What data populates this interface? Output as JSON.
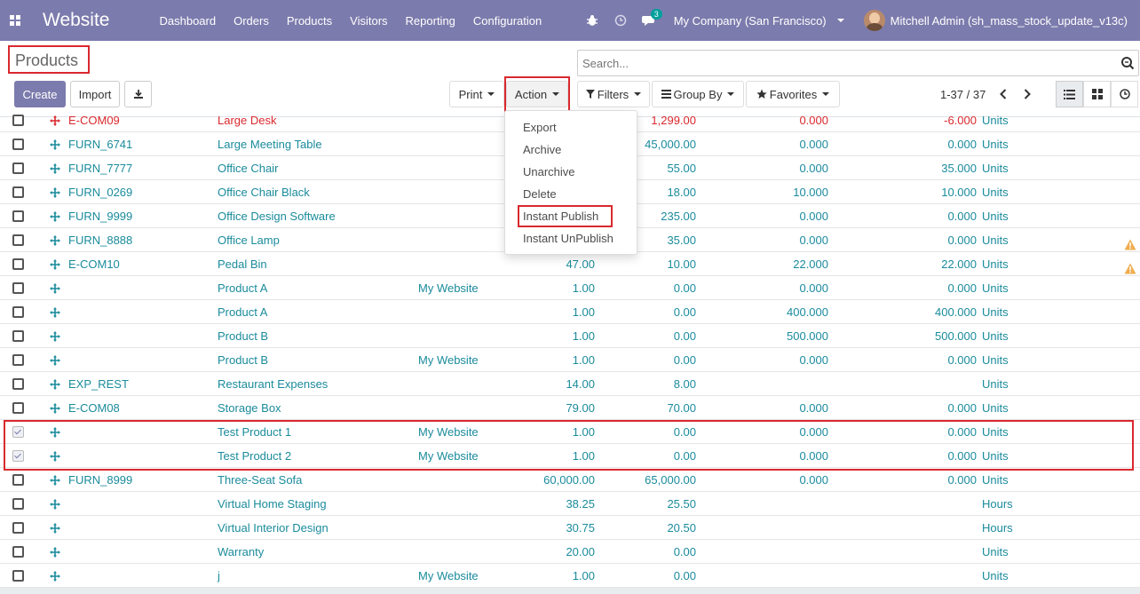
{
  "navbar": {
    "brand": "Website",
    "menu": [
      "Dashboard",
      "Orders",
      "Products",
      "Visitors",
      "Reporting",
      "Configuration"
    ],
    "chat_badge": "3",
    "company": "My Company (San Francisco)",
    "user": "Mitchell Admin (sh_mass_stock_update_v13c)"
  },
  "control_panel": {
    "title": "Products",
    "create_label": "Create",
    "import_label": "Import",
    "print_label": "Print",
    "action_label": "Action",
    "search_placeholder": "Search...",
    "filters_label": "Filters",
    "groupby_label": "Group By",
    "favorites_label": "Favorites",
    "pager": "1-37 / 37"
  },
  "action_menu": [
    "Export",
    "Archive",
    "Unarchive",
    "Delete",
    "Instant Publish",
    "Instant UnPublish"
  ],
  "rows": [
    {
      "checked": false,
      "danger": true,
      "ref": "E-COM09",
      "name": "Large Desk",
      "website": "",
      "price": "",
      "cost": "1,299.00",
      "onhand": "0.000",
      "forecast": "-6.000",
      "uom": "Units",
      "warn": false
    },
    {
      "checked": false,
      "danger": false,
      "ref": "FURN_6741",
      "name": "Large Meeting Table",
      "website": "",
      "price": "",
      "cost": "45,000.00",
      "onhand": "0.000",
      "forecast": "0.000",
      "uom": "Units",
      "warn": false
    },
    {
      "checked": false,
      "danger": false,
      "ref": "FURN_7777",
      "name": "Office Chair",
      "website": "",
      "price": "",
      "cost": "55.00",
      "onhand": "0.000",
      "forecast": "35.000",
      "uom": "Units",
      "warn": false
    },
    {
      "checked": false,
      "danger": false,
      "ref": "FURN_0269",
      "name": "Office Chair Black",
      "website": "",
      "price": "",
      "cost": "18.00",
      "onhand": "10.000",
      "forecast": "10.000",
      "uom": "Units",
      "warn": false
    },
    {
      "checked": false,
      "danger": false,
      "ref": "FURN_9999",
      "name": "Office Design Software",
      "website": "",
      "price": "",
      "cost": "235.00",
      "onhand": "0.000",
      "forecast": "0.000",
      "uom": "Units",
      "warn": false
    },
    {
      "checked": false,
      "danger": false,
      "ref": "FURN_8888",
      "name": "Office Lamp",
      "website": "",
      "price": "",
      "cost": "35.00",
      "onhand": "0.000",
      "forecast": "0.000",
      "uom": "Units",
      "warn": true
    },
    {
      "checked": false,
      "danger": false,
      "ref": "E-COM10",
      "name": "Pedal Bin",
      "website": "",
      "price": "47.00",
      "cost": "10.00",
      "onhand": "22.000",
      "forecast": "22.000",
      "uom": "Units",
      "warn": true
    },
    {
      "checked": false,
      "danger": false,
      "ref": "",
      "name": "Product A",
      "website": "My Website",
      "price": "1.00",
      "cost": "0.00",
      "onhand": "0.000",
      "forecast": "0.000",
      "uom": "Units",
      "warn": false
    },
    {
      "checked": false,
      "danger": false,
      "ref": "",
      "name": "Product A",
      "website": "",
      "price": "1.00",
      "cost": "0.00",
      "onhand": "400.000",
      "forecast": "400.000",
      "uom": "Units",
      "warn": false
    },
    {
      "checked": false,
      "danger": false,
      "ref": "",
      "name": "Product B",
      "website": "",
      "price": "1.00",
      "cost": "0.00",
      "onhand": "500.000",
      "forecast": "500.000",
      "uom": "Units",
      "warn": false
    },
    {
      "checked": false,
      "danger": false,
      "ref": "",
      "name": "Product B",
      "website": "My Website",
      "price": "1.00",
      "cost": "0.00",
      "onhand": "0.000",
      "forecast": "0.000",
      "uom": "Units",
      "warn": false
    },
    {
      "checked": false,
      "danger": false,
      "ref": "EXP_REST",
      "name": "Restaurant Expenses",
      "website": "",
      "price": "14.00",
      "cost": "8.00",
      "onhand": "",
      "forecast": "",
      "uom": "Units",
      "warn": false
    },
    {
      "checked": false,
      "danger": false,
      "ref": "E-COM08",
      "name": "Storage Box",
      "website": "",
      "price": "79.00",
      "cost": "70.00",
      "onhand": "0.000",
      "forecast": "0.000",
      "uom": "Units",
      "warn": false
    },
    {
      "checked": true,
      "danger": false,
      "ref": "",
      "name": "Test Product 1",
      "website": "My Website",
      "price": "1.00",
      "cost": "0.00",
      "onhand": "0.000",
      "forecast": "0.000",
      "uom": "Units",
      "warn": false
    },
    {
      "checked": true,
      "danger": false,
      "ref": "",
      "name": "Test Product 2",
      "website": "My Website",
      "price": "1.00",
      "cost": "0.00",
      "onhand": "0.000",
      "forecast": "0.000",
      "uom": "Units",
      "warn": false
    },
    {
      "checked": false,
      "danger": false,
      "ref": "FURN_8999",
      "name": "Three-Seat Sofa",
      "website": "",
      "price": "60,000.00",
      "cost": "65,000.00",
      "onhand": "0.000",
      "forecast": "0.000",
      "uom": "Units",
      "warn": false
    },
    {
      "checked": false,
      "danger": false,
      "ref": "",
      "name": "Virtual Home Staging",
      "website": "",
      "price": "38.25",
      "cost": "25.50",
      "onhand": "",
      "forecast": "",
      "uom": "Hours",
      "warn": false
    },
    {
      "checked": false,
      "danger": false,
      "ref": "",
      "name": "Virtual Interior Design",
      "website": "",
      "price": "30.75",
      "cost": "20.50",
      "onhand": "",
      "forecast": "",
      "uom": "Hours",
      "warn": false
    },
    {
      "checked": false,
      "danger": false,
      "ref": "",
      "name": "Warranty",
      "website": "",
      "price": "20.00",
      "cost": "0.00",
      "onhand": "",
      "forecast": "",
      "uom": "Units",
      "warn": false
    },
    {
      "checked": false,
      "danger": false,
      "ref": "",
      "name": "j",
      "website": "My Website",
      "price": "1.00",
      "cost": "0.00",
      "onhand": "",
      "forecast": "",
      "uom": "Units",
      "warn": false
    }
  ],
  "colors": {
    "brand": "#7c7bad",
    "link": "#1a8b9c",
    "danger": "#d9292e",
    "warning": "#f0ad4e"
  }
}
